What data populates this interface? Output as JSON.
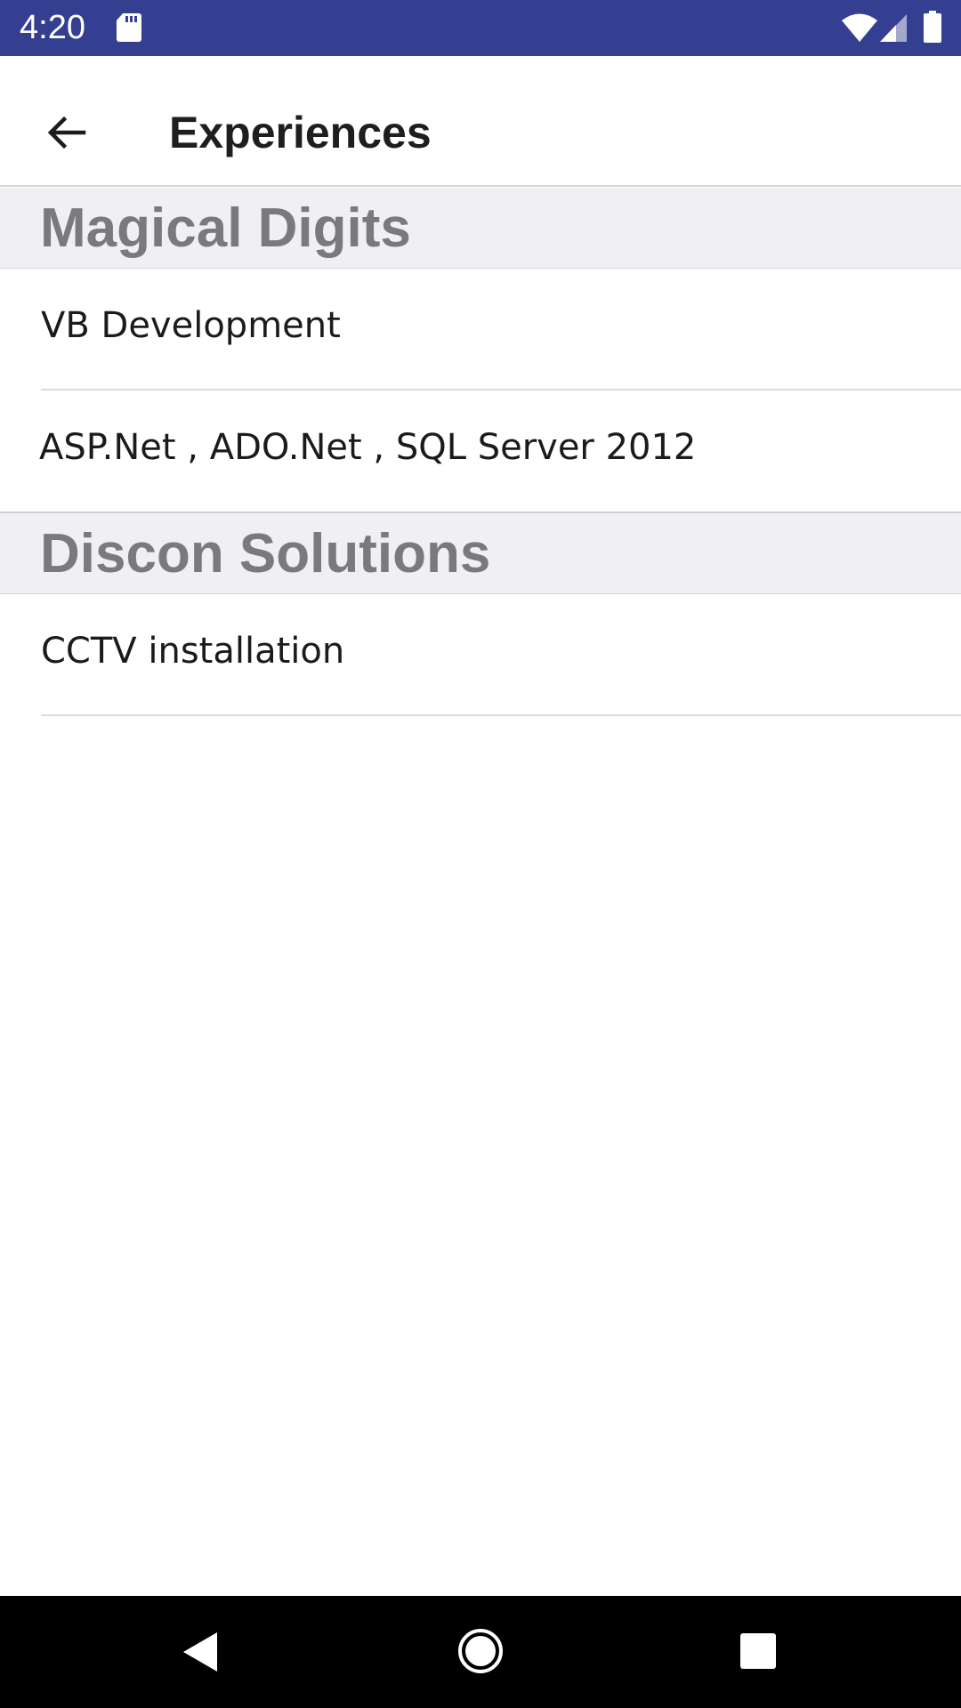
{
  "status_bar": {
    "time": "4:20",
    "icons": [
      "sd-card-icon",
      "wifi-icon",
      "cell-signal-icon",
      "battery-icon"
    ],
    "background_color": "#353f91"
  },
  "app_bar": {
    "title": "Experiences",
    "back_icon": "arrow-back-icon"
  },
  "sections": [
    {
      "title": "Magical Digits",
      "items": [
        {
          "label": "VB Development"
        },
        {
          "label": "ASP.Net , ADO.Net , SQL Server 2012"
        }
      ]
    },
    {
      "title": "Discon Solutions",
      "items": [
        {
          "label": "CCTV installation"
        }
      ]
    }
  ],
  "nav_bar": {
    "icons": [
      "nav-back-icon",
      "nav-home-icon",
      "nav-recents-icon"
    ]
  }
}
